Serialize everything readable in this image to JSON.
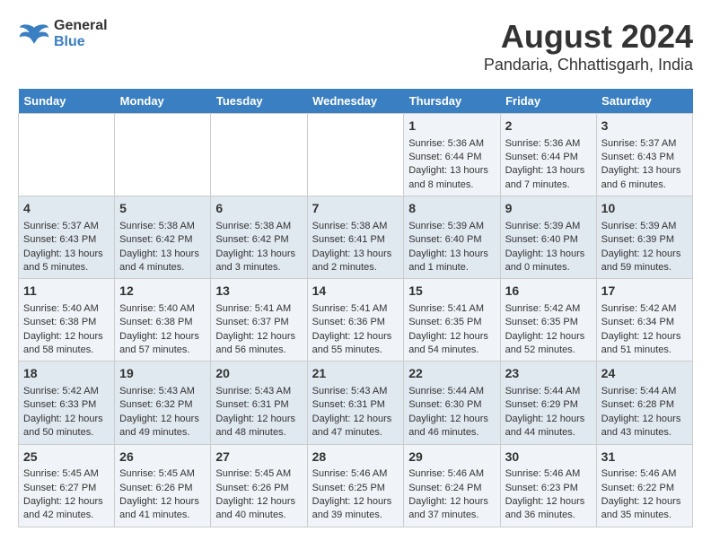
{
  "header": {
    "logo_line1": "General",
    "logo_line2": "Blue",
    "title": "August 2024",
    "subtitle": "Pandaria, Chhattisgarh, India"
  },
  "days_of_week": [
    "Sunday",
    "Monday",
    "Tuesday",
    "Wednesday",
    "Thursday",
    "Friday",
    "Saturday"
  ],
  "weeks": [
    [
      {
        "day": "",
        "info": ""
      },
      {
        "day": "",
        "info": ""
      },
      {
        "day": "",
        "info": ""
      },
      {
        "day": "",
        "info": ""
      },
      {
        "day": "1",
        "info": "Sunrise: 5:36 AM\nSunset: 6:44 PM\nDaylight: 13 hours\nand 8 minutes."
      },
      {
        "day": "2",
        "info": "Sunrise: 5:36 AM\nSunset: 6:44 PM\nDaylight: 13 hours\nand 7 minutes."
      },
      {
        "day": "3",
        "info": "Sunrise: 5:37 AM\nSunset: 6:43 PM\nDaylight: 13 hours\nand 6 minutes."
      }
    ],
    [
      {
        "day": "4",
        "info": "Sunrise: 5:37 AM\nSunset: 6:43 PM\nDaylight: 13 hours\nand 5 minutes."
      },
      {
        "day": "5",
        "info": "Sunrise: 5:38 AM\nSunset: 6:42 PM\nDaylight: 13 hours\nand 4 minutes."
      },
      {
        "day": "6",
        "info": "Sunrise: 5:38 AM\nSunset: 6:42 PM\nDaylight: 13 hours\nand 3 minutes."
      },
      {
        "day": "7",
        "info": "Sunrise: 5:38 AM\nSunset: 6:41 PM\nDaylight: 13 hours\nand 2 minutes."
      },
      {
        "day": "8",
        "info": "Sunrise: 5:39 AM\nSunset: 6:40 PM\nDaylight: 13 hours\nand 1 minute."
      },
      {
        "day": "9",
        "info": "Sunrise: 5:39 AM\nSunset: 6:40 PM\nDaylight: 13 hours\nand 0 minutes."
      },
      {
        "day": "10",
        "info": "Sunrise: 5:39 AM\nSunset: 6:39 PM\nDaylight: 12 hours\nand 59 minutes."
      }
    ],
    [
      {
        "day": "11",
        "info": "Sunrise: 5:40 AM\nSunset: 6:38 PM\nDaylight: 12 hours\nand 58 minutes."
      },
      {
        "day": "12",
        "info": "Sunrise: 5:40 AM\nSunset: 6:38 PM\nDaylight: 12 hours\nand 57 minutes."
      },
      {
        "day": "13",
        "info": "Sunrise: 5:41 AM\nSunset: 6:37 PM\nDaylight: 12 hours\nand 56 minutes."
      },
      {
        "day": "14",
        "info": "Sunrise: 5:41 AM\nSunset: 6:36 PM\nDaylight: 12 hours\nand 55 minutes."
      },
      {
        "day": "15",
        "info": "Sunrise: 5:41 AM\nSunset: 6:35 PM\nDaylight: 12 hours\nand 54 minutes."
      },
      {
        "day": "16",
        "info": "Sunrise: 5:42 AM\nSunset: 6:35 PM\nDaylight: 12 hours\nand 52 minutes."
      },
      {
        "day": "17",
        "info": "Sunrise: 5:42 AM\nSunset: 6:34 PM\nDaylight: 12 hours\nand 51 minutes."
      }
    ],
    [
      {
        "day": "18",
        "info": "Sunrise: 5:42 AM\nSunset: 6:33 PM\nDaylight: 12 hours\nand 50 minutes."
      },
      {
        "day": "19",
        "info": "Sunrise: 5:43 AM\nSunset: 6:32 PM\nDaylight: 12 hours\nand 49 minutes."
      },
      {
        "day": "20",
        "info": "Sunrise: 5:43 AM\nSunset: 6:31 PM\nDaylight: 12 hours\nand 48 minutes."
      },
      {
        "day": "21",
        "info": "Sunrise: 5:43 AM\nSunset: 6:31 PM\nDaylight: 12 hours\nand 47 minutes."
      },
      {
        "day": "22",
        "info": "Sunrise: 5:44 AM\nSunset: 6:30 PM\nDaylight: 12 hours\nand 46 minutes."
      },
      {
        "day": "23",
        "info": "Sunrise: 5:44 AM\nSunset: 6:29 PM\nDaylight: 12 hours\nand 44 minutes."
      },
      {
        "day": "24",
        "info": "Sunrise: 5:44 AM\nSunset: 6:28 PM\nDaylight: 12 hours\nand 43 minutes."
      }
    ],
    [
      {
        "day": "25",
        "info": "Sunrise: 5:45 AM\nSunset: 6:27 PM\nDaylight: 12 hours\nand 42 minutes."
      },
      {
        "day": "26",
        "info": "Sunrise: 5:45 AM\nSunset: 6:26 PM\nDaylight: 12 hours\nand 41 minutes."
      },
      {
        "day": "27",
        "info": "Sunrise: 5:45 AM\nSunset: 6:26 PM\nDaylight: 12 hours\nand 40 minutes."
      },
      {
        "day": "28",
        "info": "Sunrise: 5:46 AM\nSunset: 6:25 PM\nDaylight: 12 hours\nand 39 minutes."
      },
      {
        "day": "29",
        "info": "Sunrise: 5:46 AM\nSunset: 6:24 PM\nDaylight: 12 hours\nand 37 minutes."
      },
      {
        "day": "30",
        "info": "Sunrise: 5:46 AM\nSunset: 6:23 PM\nDaylight: 12 hours\nand 36 minutes."
      },
      {
        "day": "31",
        "info": "Sunrise: 5:46 AM\nSunset: 6:22 PM\nDaylight: 12 hours\nand 35 minutes."
      }
    ]
  ]
}
